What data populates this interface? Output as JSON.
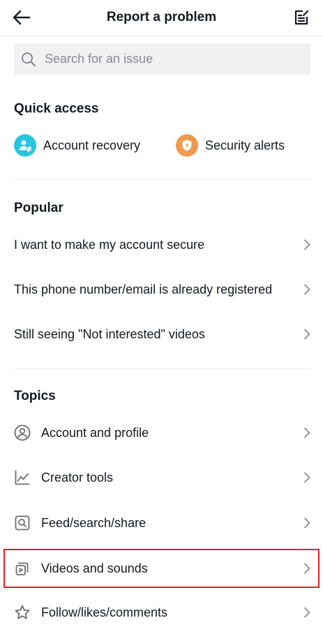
{
  "header": {
    "title": "Report a problem",
    "back_icon": "arrow-left-icon",
    "edit_icon": "edit-note-icon"
  },
  "search": {
    "placeholder": "Search for an issue",
    "icon": "search-icon"
  },
  "quick_access": {
    "title": "Quick access",
    "items": [
      {
        "label": "Account recovery",
        "icon": "account-recovery-icon",
        "color": "#25c6e0"
      },
      {
        "label": "Security alerts",
        "icon": "security-shield-icon",
        "color": "#f09a4e"
      }
    ]
  },
  "popular": {
    "title": "Popular",
    "items": [
      {
        "label": "I want to make my account secure"
      },
      {
        "label": "This phone number/email is already registered"
      },
      {
        "label": "Still seeing \"Not interested\" videos"
      }
    ]
  },
  "topics": {
    "title": "Topics",
    "items": [
      {
        "label": "Account and profile",
        "icon": "user-circle-icon"
      },
      {
        "label": "Creator tools",
        "icon": "line-chart-icon"
      },
      {
        "label": "Feed/search/share",
        "icon": "feed-search-icon"
      },
      {
        "label": "Videos and sounds",
        "icon": "video-stack-icon",
        "highlighted": true
      },
      {
        "label": "Follow/likes/comments",
        "icon": "star-icon"
      }
    ]
  },
  "colors": {
    "highlight": "#e5202b",
    "text": "#161823",
    "muted": "#8a8b91"
  }
}
